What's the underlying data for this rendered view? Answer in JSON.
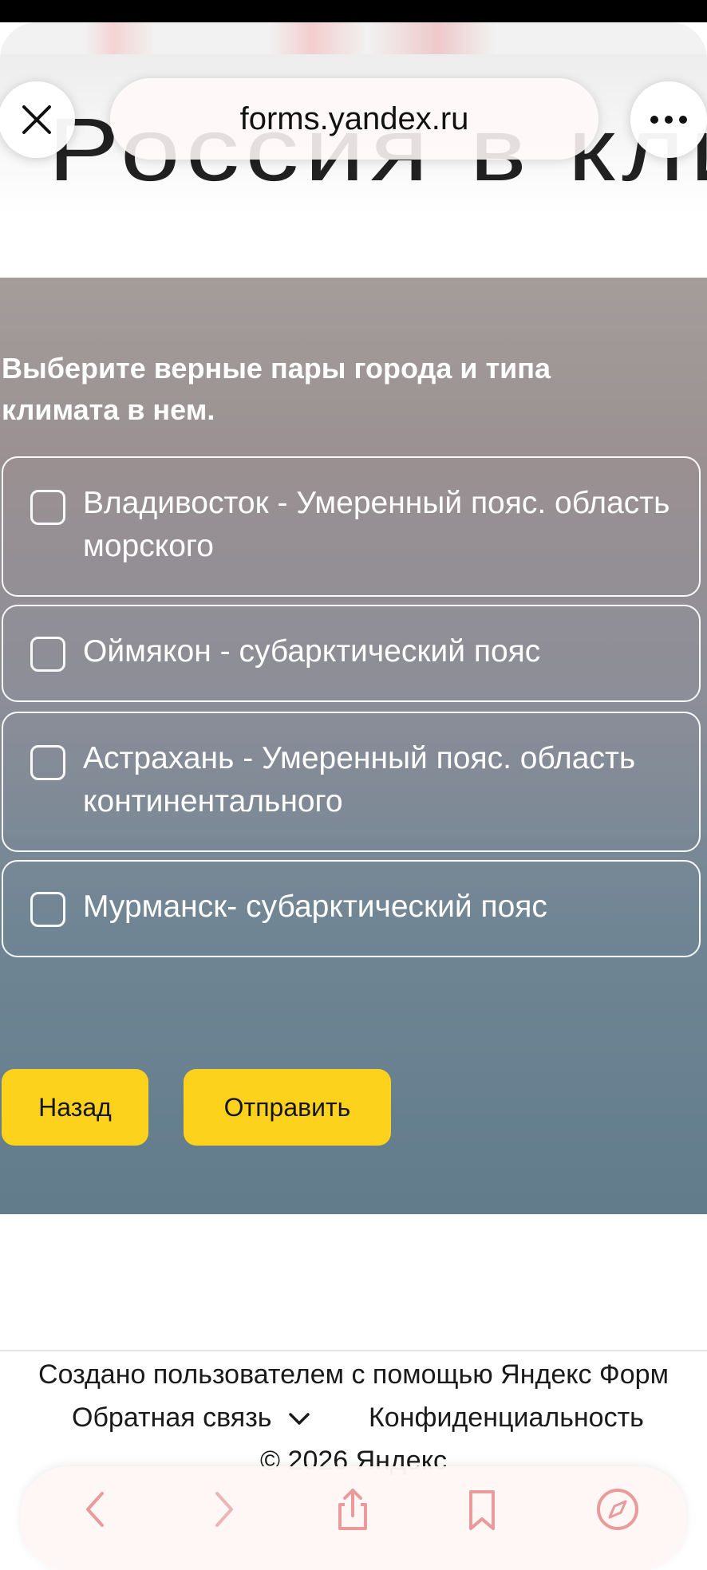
{
  "browser": {
    "url": "forms.yandex.ru"
  },
  "form": {
    "title_partial": "Россия в климат",
    "question": "Выберите верные пары города и типа климата в нем.",
    "options": [
      {
        "label": "Владивосток - Умеренный пояс. область морского",
        "checked": false
      },
      {
        "label": "Оймякон - субарктический пояс",
        "checked": false
      },
      {
        "label": "Астрахань - Умеренный пояс. область континентального",
        "checked": false
      },
      {
        "label": "Мурманск- субарктический пояс",
        "checked": false
      }
    ],
    "back_label": "Назад",
    "submit_label": "Отправить",
    "accent_color": "#fcd21c"
  },
  "footer": {
    "created_by": "Создано пользователем с помощью Яндекс Форм",
    "feedback": "Обратная связь",
    "privacy": "Конфиденциальность",
    "copyright": "© 2026 Яндекс"
  },
  "toolbar": {
    "icons": [
      "chevron-left-icon",
      "chevron-right-icon",
      "share-icon",
      "bookmark-icon",
      "compass-icon"
    ]
  }
}
